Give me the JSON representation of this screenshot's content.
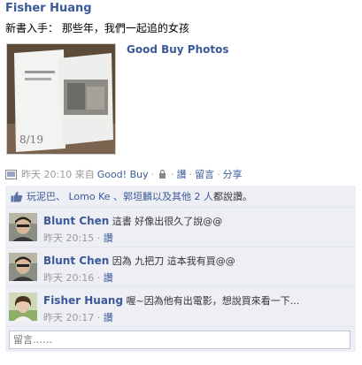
{
  "post": {
    "author": "Fisher Huang",
    "message": "新書入手： 那些年，我們一起追的女孩",
    "attachment_title": "Good Buy Photos",
    "time": "昨天 20:10 來自",
    "app": "Good! Buy",
    "like_label": "讚",
    "comment_label": "留言",
    "share_label": "分享",
    "sep": "·"
  },
  "likes": {
    "names": "玩泥巴、 Lomo Ke 、郭垣麟以及其他 2 人",
    "suffix": "都說讚。"
  },
  "comments": [
    {
      "author": "Blunt Chen",
      "text": "這書 好像出很久了說@@",
      "time": "昨天 20:15",
      "like": "讚"
    },
    {
      "author": "Blunt Chen",
      "text": "因為 九把刀 這本我有買@@",
      "time": "昨天 20:16",
      "like": "讚"
    },
    {
      "author": "Fisher Huang",
      "text": "喔~因為他有出電影，想說買來看一下...",
      "time": "昨天 20:17",
      "like": "讚"
    }
  ],
  "comment_box": {
    "placeholder": "留言……"
  },
  "colors": {
    "link": "#3b5998",
    "ufi_bg": "#edeff4"
  }
}
